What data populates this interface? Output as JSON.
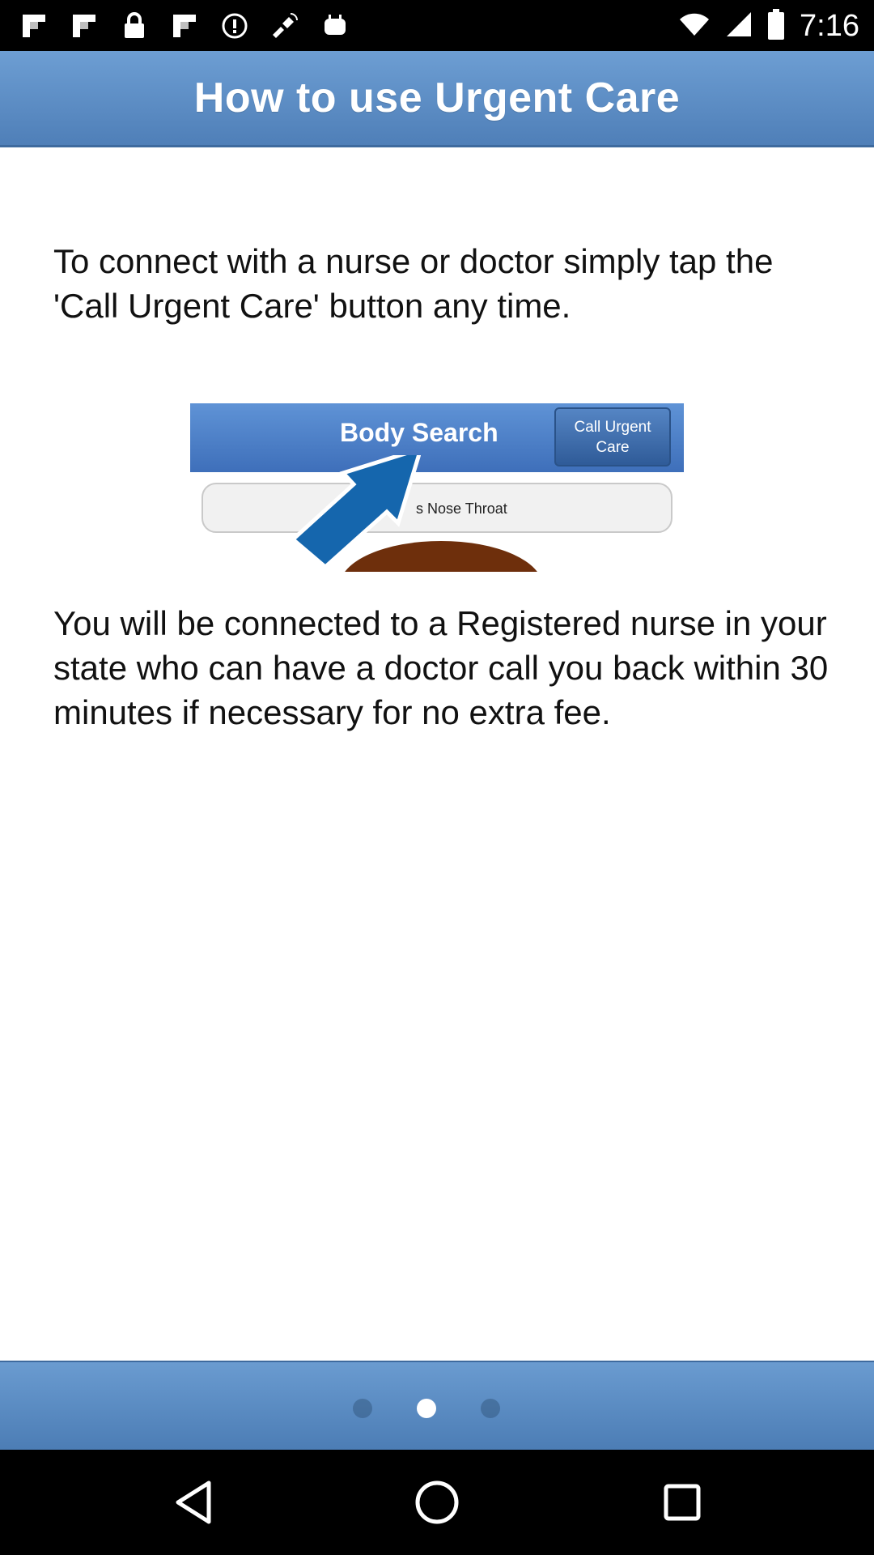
{
  "status_bar": {
    "time": "7:16",
    "left_icons": [
      "flipboard-icon",
      "flipboard-icon",
      "lock-icon",
      "flipboard-icon",
      "info-icon",
      "fake-gps-icon",
      "android-icon"
    ],
    "right_icons": [
      "wifi-icon",
      "signal-icon",
      "battery-icon"
    ]
  },
  "header": {
    "title": "How to use Urgent Care"
  },
  "content": {
    "paragraph_1": "To connect with a nurse or doctor simply tap the 'Call Urgent Care' button any time.",
    "paragraph_2": "You will be connected to a Registered nurse in your state who can have a doctor call you back within 30 minutes if necessary for no extra fee."
  },
  "preview_image": {
    "title": "Body Search",
    "call_button": "Call Urgent Care",
    "search_text": "s Nose Throat"
  },
  "pager": {
    "total_pages": 3,
    "current_page": 2
  },
  "nav_bar": {
    "buttons": [
      "back-icon",
      "home-icon",
      "recents-icon"
    ]
  },
  "colors": {
    "header_blue": "#5a8bc6",
    "footer_blue": "#5b8cc3",
    "arrow_blue": "#1566ad",
    "text": "#111111",
    "background": "#ffffff"
  }
}
